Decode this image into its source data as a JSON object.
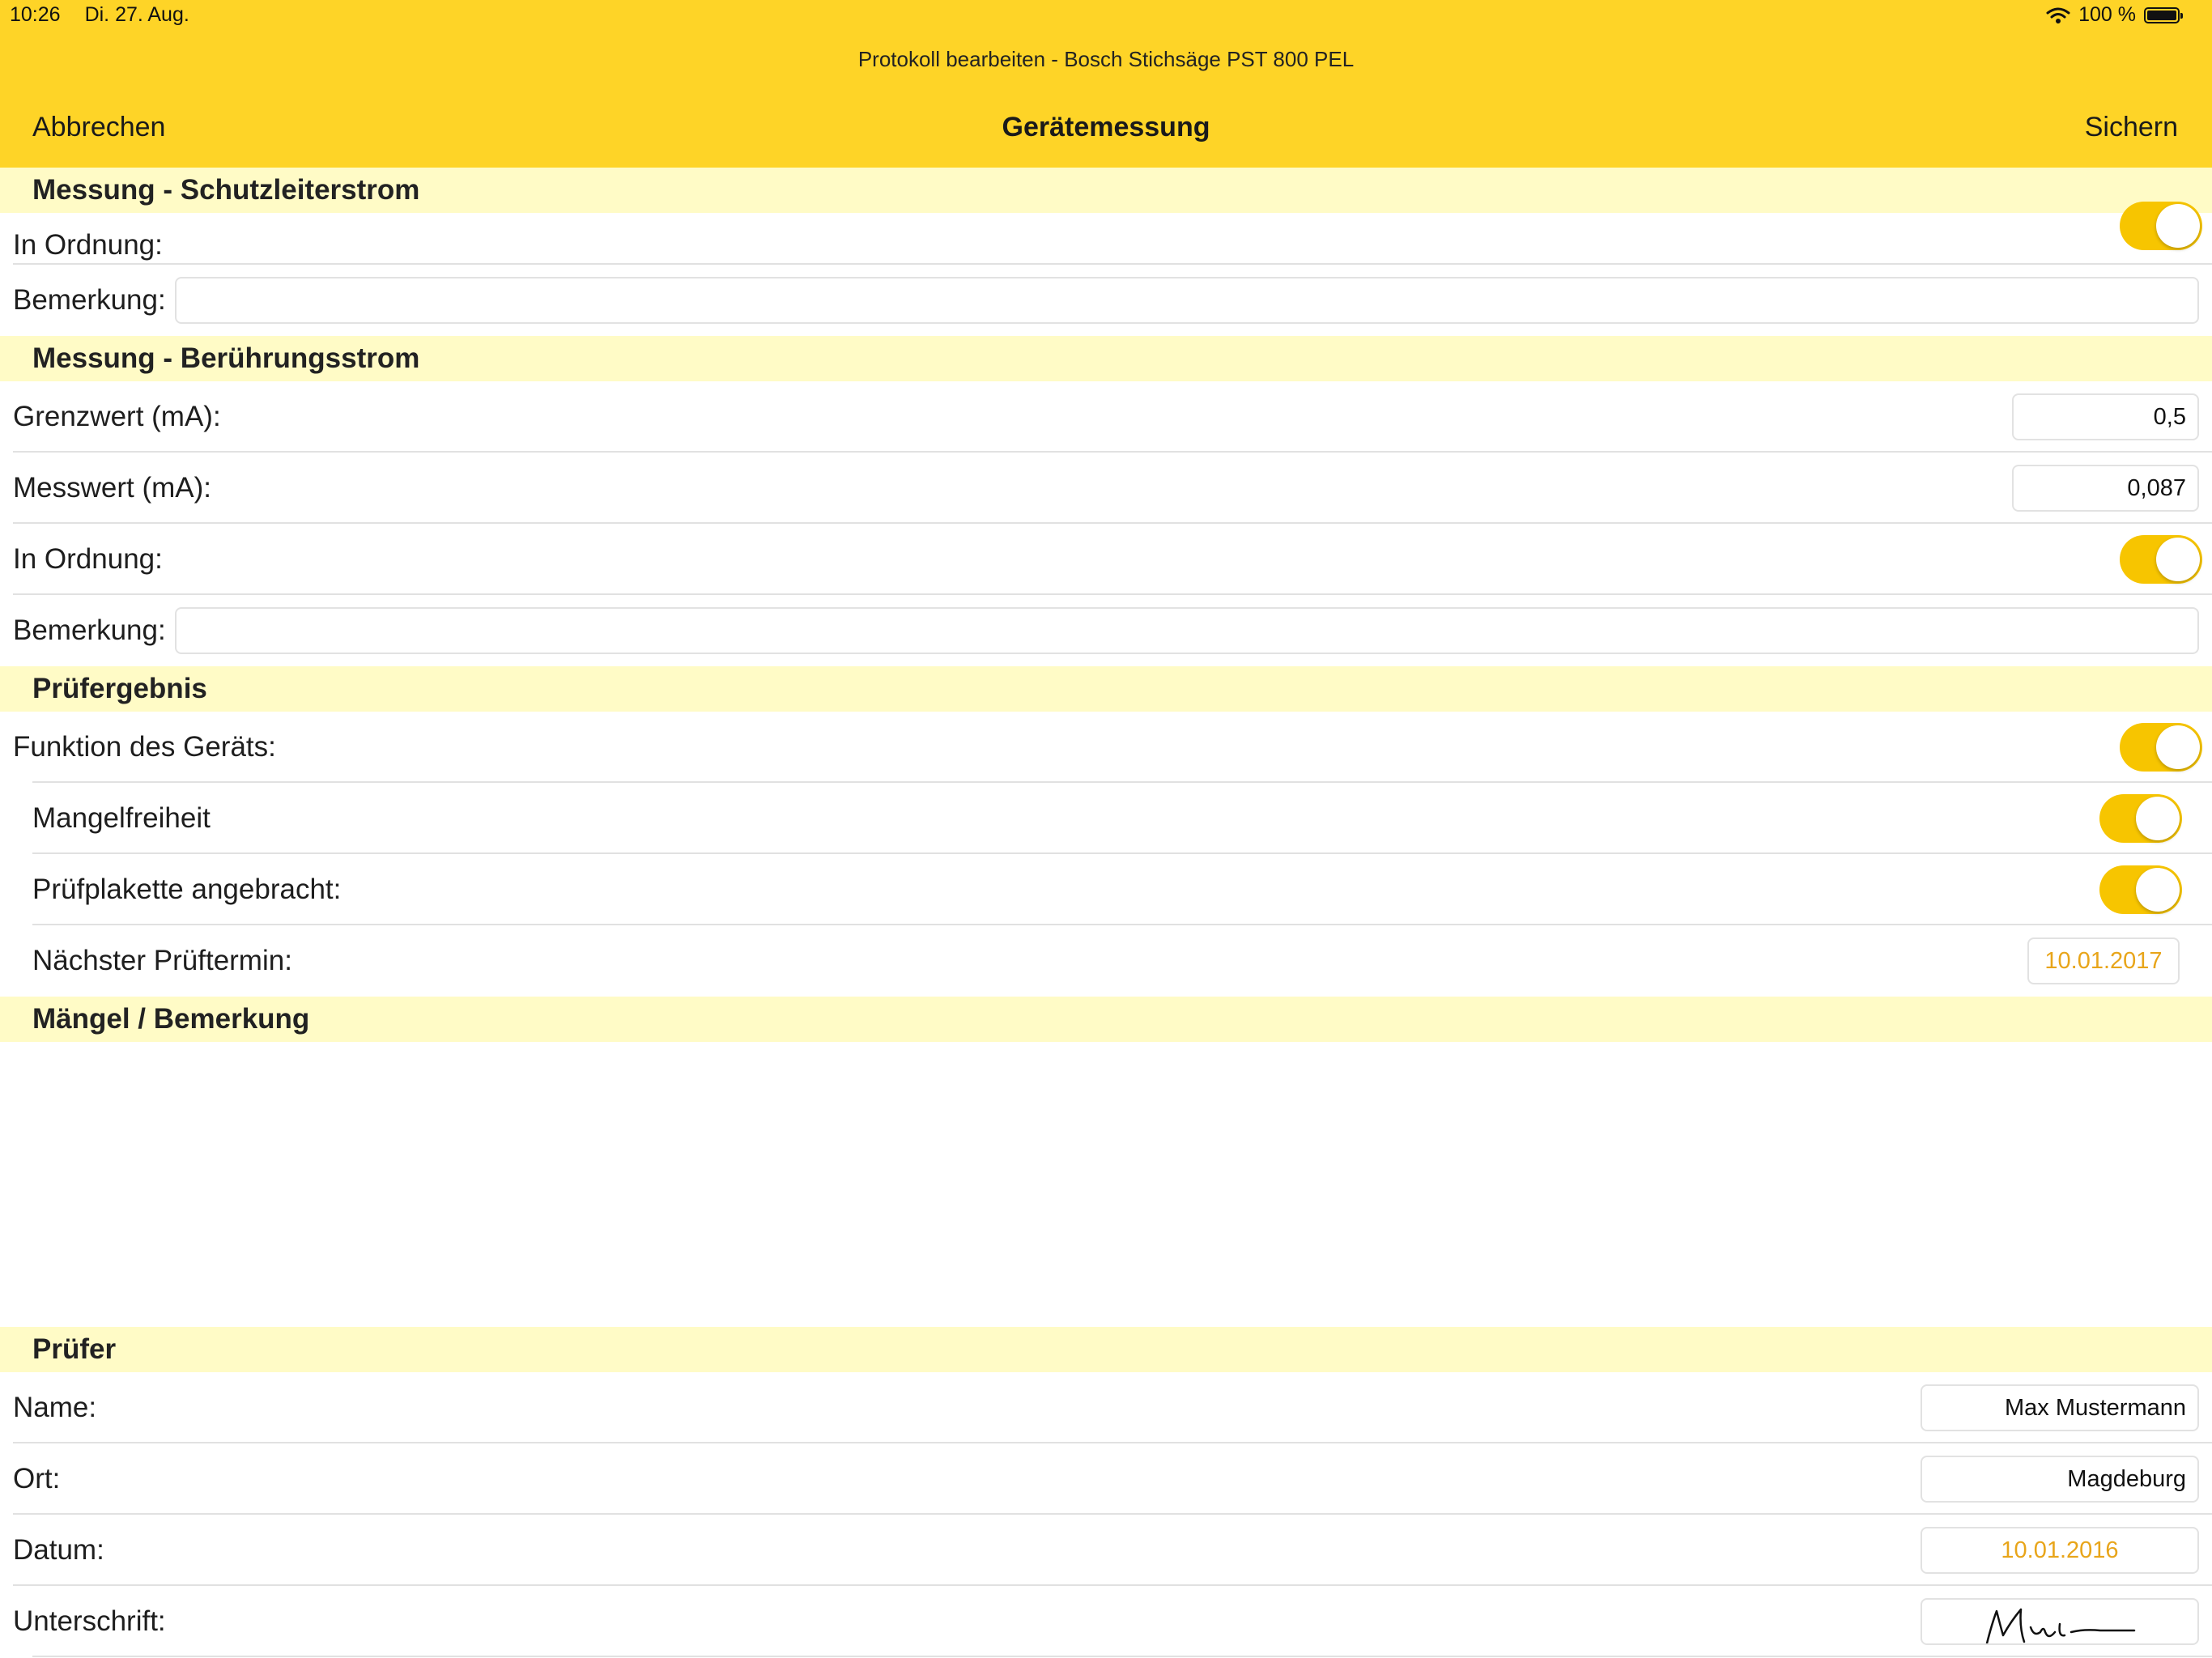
{
  "status_bar": {
    "time": "10:26",
    "date": "Di. 27. Aug.",
    "battery": "100 %"
  },
  "header": {
    "window_title": "Protokoll bearbeiten - Bosch Stichsäge PST 800 PEL",
    "cancel_label": "Abbrechen",
    "title": "Gerätemessung",
    "save_label": "Sichern"
  },
  "schutzleiter": {
    "title": "Messung - Schutzleiterstrom",
    "ok_label": "In Ordnung:",
    "ok_on": true,
    "remark_label": "Bemerkung:",
    "remark_value": ""
  },
  "beruehrung": {
    "title": "Messung - Berührungsstrom",
    "limit_label": "Grenzwert (mA):",
    "limit_value": "0,5",
    "measured_label": "Messwert (mA):",
    "measured_value": "0,087",
    "ok_label": "In Ordnung:",
    "ok_on": true,
    "remark_label": "Bemerkung:",
    "remark_value": ""
  },
  "ergebnis": {
    "title": "Prüfergebnis",
    "function_label": "Funktion des Geräts:",
    "function_on": true,
    "defect_free_label": "Mangelfreiheit",
    "defect_free_on": true,
    "sticker_label": "Prüfplakette angebracht:",
    "sticker_on": true,
    "next_date_label": "Nächster Prüftermin:",
    "next_date_value": "10.01.2017"
  },
  "maengel": {
    "title": "Mängel / Bemerkung",
    "text": ""
  },
  "pruefer": {
    "title": "Prüfer",
    "name_label": "Name:",
    "name_value": "Max Mustermann",
    "place_label": "Ort:",
    "place_value": "Magdeburg",
    "date_label": "Datum:",
    "date_value": "10.01.2016",
    "signature_label": "Unterschrift:"
  },
  "colors": {
    "accent": "#fed427",
    "toggle_on": "#f7c500",
    "section_bg": "#fffbc6",
    "date_text": "#e8a51a"
  },
  "icons": {
    "wifi": "wifi-icon",
    "battery": "battery-icon"
  }
}
